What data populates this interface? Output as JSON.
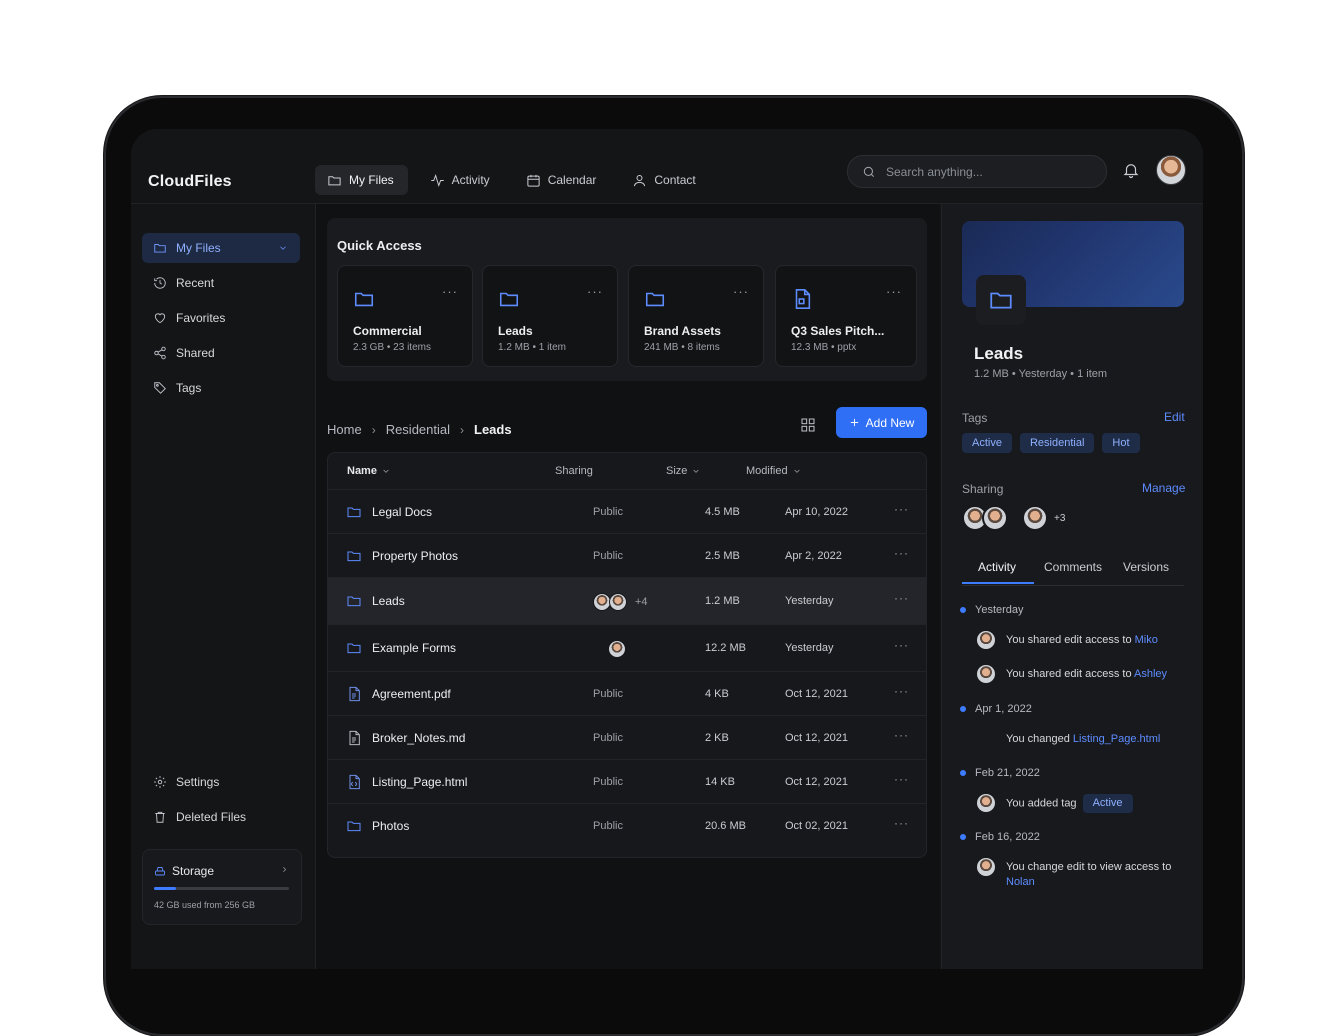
{
  "app": {
    "title": "CloudFiles"
  },
  "topnav": {
    "items": [
      {
        "label": "My Files",
        "icon": "folder-icon"
      },
      {
        "label": "Activity",
        "icon": "activity-icon"
      },
      {
        "label": "Calendar",
        "icon": "calendar-icon"
      },
      {
        "label": "Contact",
        "icon": "user-icon"
      }
    ],
    "active": "My Files"
  },
  "search": {
    "placeholder": "Search anything...",
    "value": ""
  },
  "sidebar": {
    "items": [
      {
        "label": "My Files",
        "icon": "folder-icon"
      },
      {
        "label": "Recent",
        "icon": "history-icon"
      },
      {
        "label": "Favorites",
        "icon": "heart-icon"
      },
      {
        "label": "Shared",
        "icon": "share-icon"
      },
      {
        "label": "Tags",
        "icon": "tag-icon"
      }
    ],
    "bottom": [
      {
        "label": "Settings",
        "icon": "gear-icon"
      },
      {
        "label": "Deleted Files",
        "icon": "trash-icon"
      }
    ],
    "storage": {
      "label": "Storage",
      "used_text": "42 GB used from 256 GB",
      "used_fraction": 0.164
    }
  },
  "quick_access": {
    "title": "Quick Access",
    "cards": [
      {
        "name": "Commercial",
        "meta": "2.3 GB • 23 items",
        "icon": "folder-icon"
      },
      {
        "name": "Leads",
        "meta": "1.2 MB • 1 item",
        "icon": "folder-icon"
      },
      {
        "name": "Brand Assets",
        "meta": "241 MB • 8 items",
        "icon": "folder-icon"
      },
      {
        "name": "Q3 Sales Pitch...",
        "meta": "12.3 MB • pptx",
        "icon": "presentation-file-icon"
      }
    ]
  },
  "breadcrumb": {
    "items": [
      "Home",
      "Residential"
    ],
    "current": "Leads"
  },
  "toolbar": {
    "add_label": "Add New"
  },
  "table": {
    "columns": {
      "name": "Name",
      "sharing": "Sharing",
      "size": "Size",
      "modified": "Modified"
    },
    "rows": [
      {
        "name": "Legal Docs",
        "sharing": "Public",
        "size": "4.5 MB",
        "modified": "Apr 10, 2022",
        "type": "folder"
      },
      {
        "name": "Property Photos",
        "sharing": "Public",
        "size": "2.5 MB",
        "modified": "Apr 2, 2022",
        "type": "folder"
      },
      {
        "name": "Leads",
        "sharing": "",
        "shared_extra": "+4",
        "size": "1.2 MB",
        "modified": "Yesterday",
        "type": "folder"
      },
      {
        "name": "Example Forms",
        "sharing": "",
        "size": "12.2 MB",
        "modified": "Yesterday",
        "type": "folder"
      },
      {
        "name": "Agreement.pdf",
        "sharing": "Public",
        "size": "4 KB",
        "modified": "Oct 12, 2021",
        "type": "pdf"
      },
      {
        "name": "Broker_Notes.md",
        "sharing": "Public",
        "size": "2 KB",
        "modified": "Oct 12, 2021",
        "type": "doc"
      },
      {
        "name": "Listing_Page.html",
        "sharing": "Public",
        "size": "14 KB",
        "modified": "Oct 12, 2021",
        "type": "html"
      },
      {
        "name": "Photos",
        "sharing": "Public",
        "size": "20.6 MB",
        "modified": "Oct 02, 2021",
        "type": "folder"
      }
    ]
  },
  "details": {
    "title": "Leads",
    "meta": "1.2 MB • Yesterday • 1 item",
    "tags_label": "Tags",
    "tags_edit": "Edit",
    "tags": [
      "Active",
      "Residential",
      "Hot"
    ],
    "sharing_label": "Sharing",
    "sharing_manage": "Manage",
    "sharing_extra": "+3",
    "tabs": [
      "Activity",
      "Comments",
      "Versions"
    ],
    "active_tab": "Activity",
    "timeline": [
      {
        "date": "Yesterday",
        "events": [
          {
            "text": "You shared edit access to ",
            "highlight": "Miko"
          },
          {
            "text": "You shared edit access to ",
            "highlight": "Ashley"
          }
        ]
      },
      {
        "date": "Apr 1, 2022",
        "events": [
          {
            "text": "You changed ",
            "highlight": "Listing_Page.html"
          }
        ]
      },
      {
        "date": "Feb 21, 2022",
        "events": [
          {
            "text": "You added tag",
            "tag": "Active"
          }
        ]
      },
      {
        "date": "Feb 16, 2022",
        "events": [
          {
            "text": "You change edit to view access to",
            "highlight": "Nolan"
          }
        ]
      }
    ]
  },
  "colors": {
    "accent": "#2f6ff5",
    "background": "#141517",
    "link": "#5d8cff"
  }
}
